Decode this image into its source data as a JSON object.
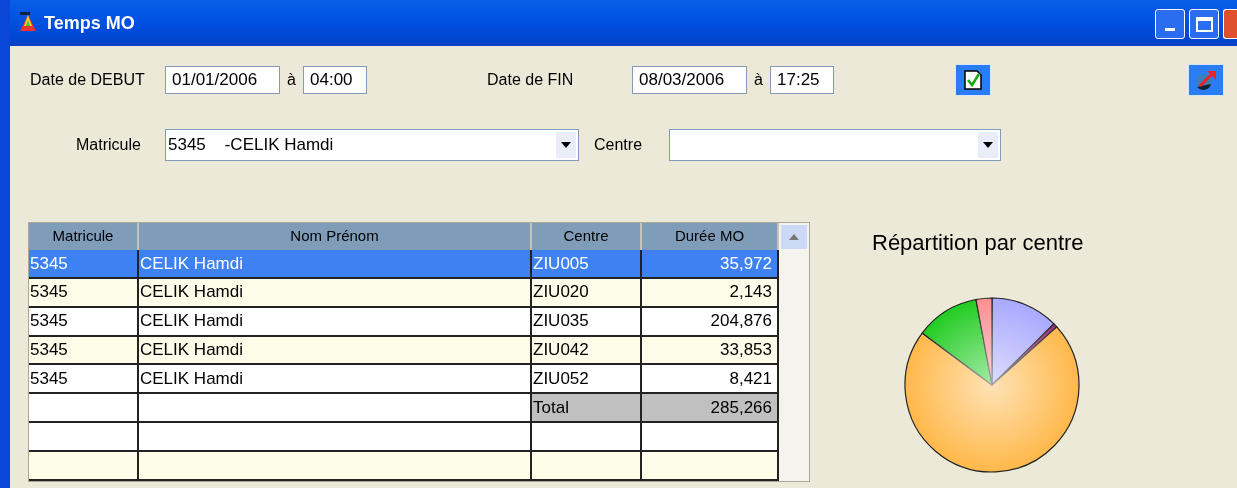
{
  "window": {
    "title": "Temps MO"
  },
  "filters": {
    "start_label": "Date de DEBUT",
    "start_date": "01/01/2006",
    "start_sep": "à",
    "start_time": "04:00",
    "end_label": "Date de FIN",
    "end_date": "08/03/2006",
    "end_sep": "à",
    "end_time": "17:25",
    "matricule_label": "Matricule",
    "matricule_value": "5345    -CELIK Hamdi",
    "centre_label": "Centre"
  },
  "table": {
    "columns": [
      "Matricule",
      "Nom Prénom",
      "Centre",
      "Durée MO"
    ],
    "rows": [
      {
        "kind": "data",
        "selected": true,
        "cells": [
          "5345",
          "CELIK Hamdi",
          "ZIU005",
          "35,972"
        ]
      },
      {
        "kind": "data",
        "selected": false,
        "cells": [
          "5345",
          "CELIK Hamdi",
          "ZIU020",
          "2,143"
        ]
      },
      {
        "kind": "data",
        "selected": false,
        "cells": [
          "5345",
          "CELIK Hamdi",
          "ZIU035",
          "204,876"
        ]
      },
      {
        "kind": "data",
        "selected": false,
        "cells": [
          "5345",
          "CELIK Hamdi",
          "ZIU042",
          "33,853"
        ]
      },
      {
        "kind": "data",
        "selected": false,
        "cells": [
          "5345",
          "CELIK Hamdi",
          "ZIU052",
          "8,421"
        ]
      },
      {
        "kind": "total",
        "selected": false,
        "cells": [
          "",
          "",
          "Total",
          "285,266"
        ]
      }
    ]
  },
  "chart": {
    "title": "Répartition par centre"
  }
}
